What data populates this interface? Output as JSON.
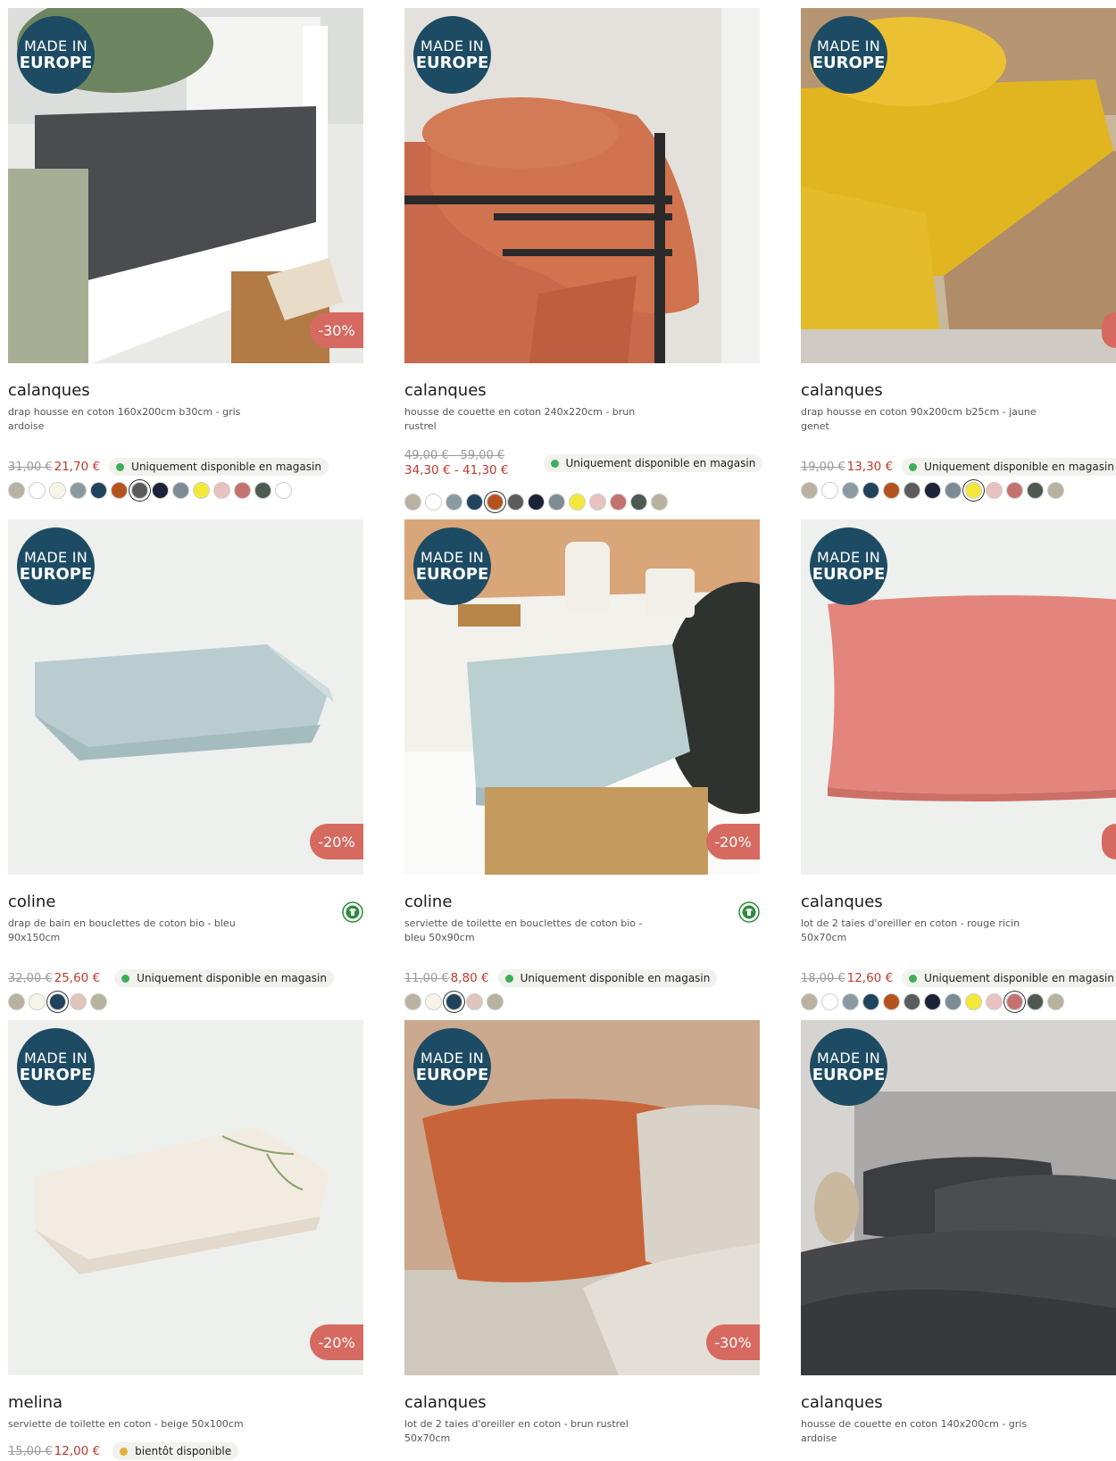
{
  "badges": {
    "made_in_line1": "MADE IN",
    "made_in_line2": "EUROPE"
  },
  "colors": {
    "badge_bg": "#1d4b63",
    "discount_bg": "#d66a60",
    "price_red": "#c0392b",
    "in_store_dot": "#3fae5a",
    "soon_dot": "#e0b233"
  },
  "products": [
    {
      "brand": "calanques",
      "description": "drap housse en coton 160x200cm b30cm - gris ardoise",
      "old_price": "31,00 €",
      "new_price": "21,70 €",
      "discount": "-30%",
      "availability": "Uniquement disponible en magasin",
      "swatches": [
        "#b9b1a1",
        "#ffffff",
        "#f6f4ea",
        "#8a9aa0",
        "#20445c",
        "#b5531f",
        "#5b5c5e",
        "#1c2338",
        "#7d8b95",
        "#f2e83a",
        "#e8c2c0",
        "#c47270",
        "#4d5951",
        "#ffffff"
      ],
      "selected_swatch": 6
    },
    {
      "brand": "calanques",
      "description": "housse de couette en coton 240x220cm - brun rustrel",
      "old_price": "49,00 € - 59,00 €",
      "new_price": "34,30 € - 41,30 €",
      "availability": "Uniquement disponible en magasin",
      "swatches": [
        "#b9b1a1",
        "#ffffff",
        "#8a9aa0",
        "#20445c",
        "#b5531f",
        "#5b5c5e",
        "#1c2338",
        "#7d8b95",
        "#f2e83a",
        "#e8c2c0",
        "#c47270",
        "#4d5951",
        "#b6b29f"
      ],
      "selected_swatch": 4
    },
    {
      "brand": "calanques",
      "description": "drap housse en coton 90x200cm b25cm - jaune genet",
      "old_price": "19,00 €",
      "new_price": "13,30 €",
      "availability": "Uniquement disponible en magasin",
      "swatches": [
        "#b9b1a1",
        "#ffffff",
        "#8a9aa0",
        "#20445c",
        "#b5531f",
        "#5b5c5e",
        "#1c2338",
        "#7d8b95",
        "#f2e83a",
        "#e8c2c0",
        "#c47270",
        "#4d5951",
        "#b6b29f"
      ],
      "selected_swatch": 8
    },
    {
      "brand": "coline",
      "description": "drap de bain en bouclettes de coton bio - bleu 90x150cm",
      "old_price": "32,00 €",
      "new_price": "25,60 €",
      "discount": "-20%",
      "availability": "Uniquement disponible en magasin",
      "swatches": [
        "#b9b1a1",
        "#f6f4ea",
        "#20445c",
        "#e0c4bd",
        "#b6b29f"
      ],
      "selected_swatch": 2
    },
    {
      "brand": "coline",
      "description": "serviette de toilette en bouclettes de coton bio - bleu 50x90cm",
      "old_price": "11,00 €",
      "new_price": "8,80 €",
      "discount": "-20%",
      "availability": "Uniquement disponible en magasin",
      "swatches": [
        "#b9b1a1",
        "#f6f4ea",
        "#20445c",
        "#e0c4bd",
        "#b6b29f"
      ],
      "selected_swatch": 2
    },
    {
      "brand": "calanques",
      "description": "lot de 2 taies d'oreiller en coton - rouge ricin 50x70cm",
      "old_price": "18,00 €",
      "new_price": "12,60 €",
      "availability": "Uniquement disponible en magasin",
      "swatches": [
        "#b9b1a1",
        "#ffffff",
        "#8a9aa0",
        "#20445c",
        "#b5531f",
        "#5b5c5e",
        "#1c2338",
        "#7d8b95",
        "#f2e83a",
        "#e8c2c0",
        "#c47270",
        "#4d5951",
        "#b6b29f"
      ],
      "selected_swatch": 10
    },
    {
      "brand": "melina",
      "description": "serviette de toilette en coton - beige 50x100cm",
      "old_price": "15,00 €",
      "new_price": "12,00 €",
      "discount": "-20%",
      "availability": "bientôt disponible"
    },
    {
      "brand": "calanques",
      "description": "lot de 2 taies d'oreiller en coton - brun rustrel 50x70cm",
      "discount": "-30%"
    },
    {
      "brand": "calanques",
      "description": "housse de couette en coton 140x200cm - gris ardoise"
    }
  ]
}
